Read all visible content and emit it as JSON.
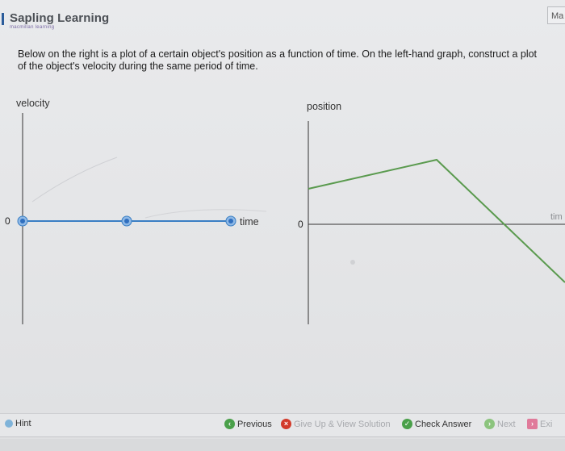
{
  "header": {
    "brand": "Sapling Learning",
    "sub_brand": "macmillan learning",
    "corner_text": "Ma"
  },
  "question": {
    "text": "Below on the right is a plot of a certain object's position as a function of time. On the left-hand graph, construct a plot of the object's velocity during the same period of time."
  },
  "velocity_graph": {
    "y_label": "velocity",
    "x_label": "time",
    "origin_label": "0",
    "points": [
      {
        "t": 0,
        "v": 0
      },
      {
        "t": 0.5,
        "v": 0
      },
      {
        "t": 1,
        "v": 0
      }
    ]
  },
  "position_graph": {
    "y_label": "position",
    "x_label": "tim",
    "origin_label": "0",
    "line_color": "#5a9a4e",
    "segments": [
      {
        "t": 0,
        "x": 0.55
      },
      {
        "t": 0.5,
        "x": 1.0
      },
      {
        "t": 1.0,
        "x": -0.9
      }
    ]
  },
  "footer": {
    "hint": "Hint",
    "previous": "Previous",
    "give_up": "Give Up & View Solution",
    "check_answer": "Check Answer",
    "next": "Next",
    "exit": "Exi"
  },
  "colors": {
    "velocity_line": "#3a7fc4",
    "point_fill": "#2f6fbf",
    "axis": "#333333",
    "previous_icon": "#4aa04a",
    "giveup_icon": "#d23a2a",
    "check_icon": "#4aa04a",
    "next_icon": "#5aa64a",
    "exit_icon": "#e04a7a"
  }
}
